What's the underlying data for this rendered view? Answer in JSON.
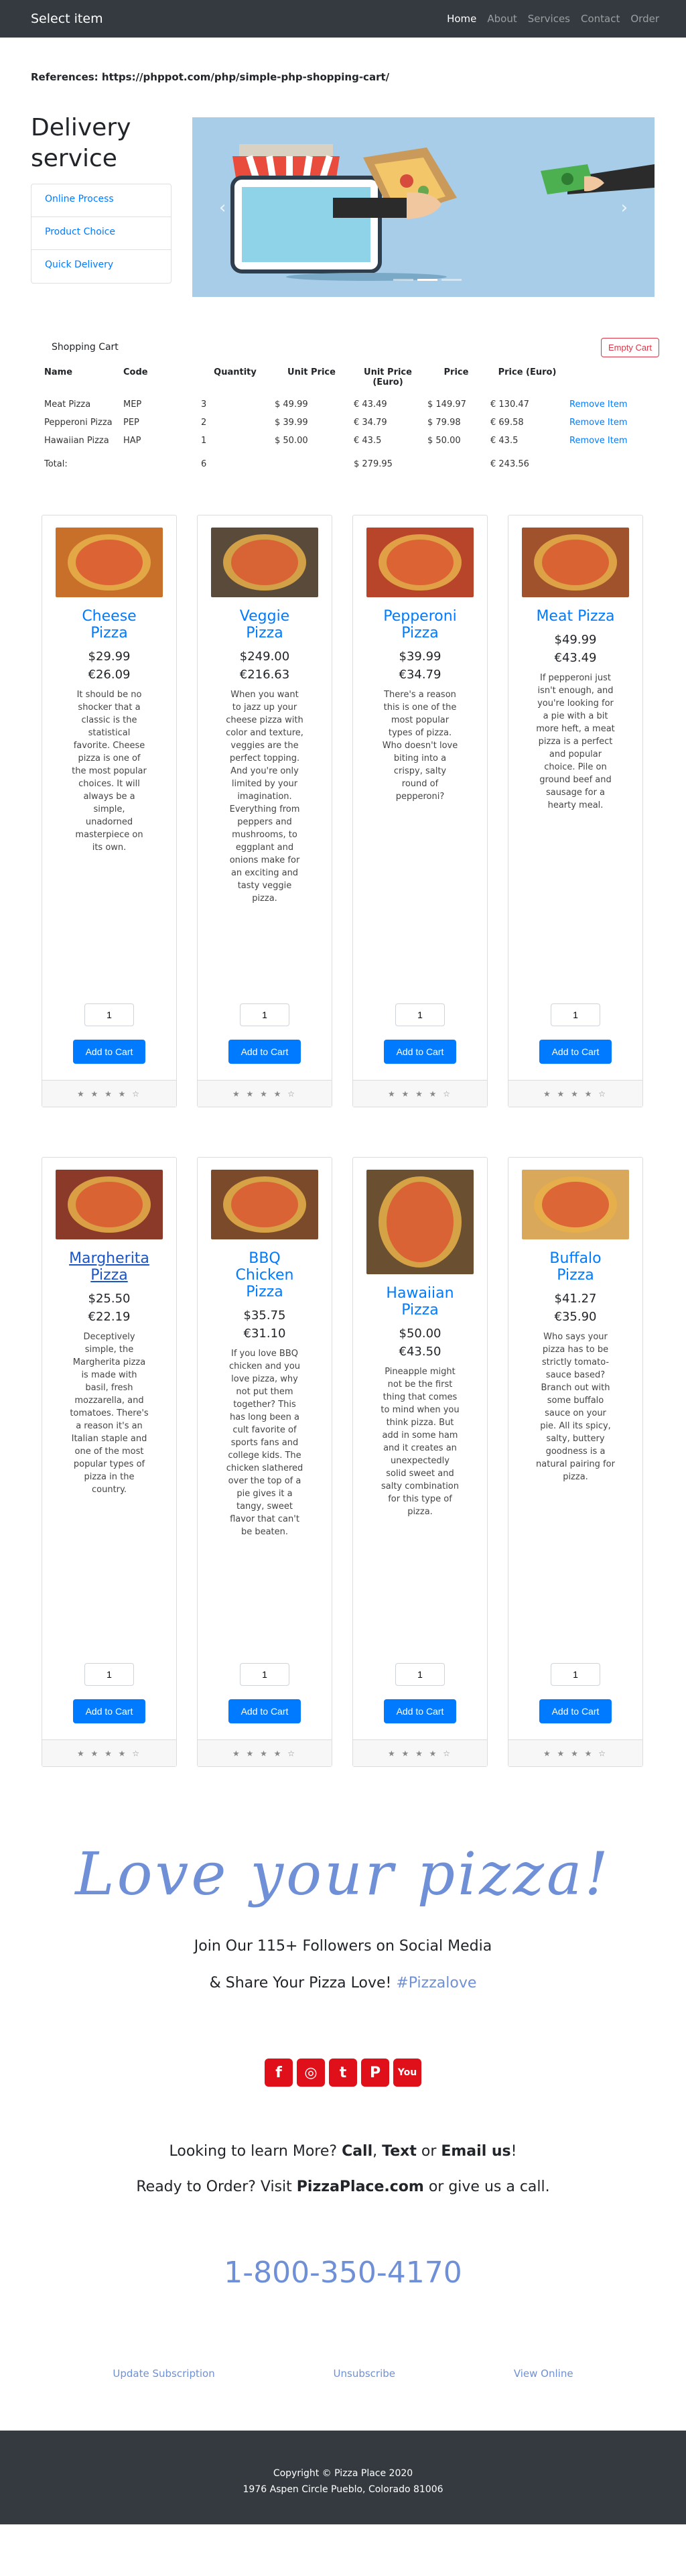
{
  "nav": {
    "brand": "Select item",
    "links": [
      "Home",
      "About",
      "Services",
      "Contact",
      "Order"
    ]
  },
  "references": "References: https://phppot.com/php/simple-php-shopping-cart/",
  "hero": {
    "title_line1": "Delivery",
    "title_line2": "service",
    "side_items": [
      "Online Process",
      "Product Choice",
      "Quick Delivery"
    ],
    "carousel": {
      "prev": "‹",
      "next": "›"
    }
  },
  "cart": {
    "title": "Shopping Cart",
    "empty_label": "Empty Cart",
    "columns": [
      "Name",
      "Code",
      "Quantity",
      "Unit Price",
      "Unit Price (Euro)",
      "Price",
      "Price (Euro)"
    ],
    "rows": [
      {
        "name": "Meat Pizza",
        "code": "MEP",
        "qty": "3",
        "unit": "$ 49.99",
        "unit_eur": "€ 43.49",
        "price": "$ 149.97",
        "price_eur": "€ 130.47",
        "remove": "Remove Item"
      },
      {
        "name": "Pepperoni Pizza",
        "code": "PEP",
        "qty": "2",
        "unit": "$ 39.99",
        "unit_eur": "€ 34.79",
        "price": "$ 79.98",
        "price_eur": "€ 69.58",
        "remove": "Remove Item"
      },
      {
        "name": "Hawaiian Pizza",
        "code": "HAP",
        "qty": "1",
        "unit": "$ 50.00",
        "unit_eur": "€ 43.5",
        "price": "$ 50.00",
        "price_eur": "€ 43.5",
        "remove": "Remove Item"
      }
    ],
    "total_label": "Total:",
    "total_qty": "6",
    "total_usd": "$ 279.95",
    "total_eur": "€ 243.56"
  },
  "products": [
    {
      "name": "Cheese Pizza",
      "price": "$29.99",
      "price_eur": "€26.09",
      "desc": "It should be no shocker that a classic is the statistical favorite. Cheese pizza is one of the most popular choices. It will always be a simple, unadorned masterpiece on its own.",
      "qty": "1",
      "btn": "Add to Cart",
      "stars": "★ ★ ★ ★ ☆",
      "color": "#c8702a"
    },
    {
      "name": "Veggie Pizza",
      "price": "$249.00",
      "price_eur": "€216.63",
      "desc": "When you want to jazz up your cheese pizza with color and texture, veggies are the perfect topping. And you're only limited by your imagination. Everything from peppers and mushrooms, to eggplant and onions make for an exciting and tasty veggie pizza.",
      "qty": "1",
      "btn": "Add to Cart",
      "stars": "★ ★ ★ ★ ☆",
      "color": "#5a4a3a"
    },
    {
      "name": "Pepperoni Pizza",
      "price": "$39.99",
      "price_eur": "€34.79",
      "desc": "There's a reason this is one of the most popular types of pizza. Who doesn't love biting into a crispy, salty round of pepperoni?",
      "qty": "1",
      "btn": "Add to Cart",
      "stars": "★ ★ ★ ★ ☆",
      "color": "#b8442a"
    },
    {
      "name": "Meat Pizza",
      "price": "$49.99",
      "price_eur": "€43.49",
      "desc": "If pepperoni just isn't enough, and you're looking for a pie with a bit more heft, a meat pizza is a perfect and popular choice. Pile on ground beef and sausage for a hearty meal.",
      "qty": "1",
      "btn": "Add to Cart",
      "stars": "★ ★ ★ ★ ☆",
      "color": "#a0522d"
    },
    {
      "name": "Margherita Pizza",
      "price": "$25.50",
      "price_eur": "€22.19",
      "desc": "Deceptively simple, the Margherita pizza is made with basil, fresh mozzarella, and tomatoes. There's a reason it's an Italian staple and one of the most popular types of pizza in the country.",
      "qty": "1",
      "btn": "Add to Cart",
      "stars": "★ ★ ★ ★ ☆",
      "color": "#8b3a2a"
    },
    {
      "name": "BBQ Chicken Pizza",
      "price": "$35.75",
      "price_eur": "€31.10",
      "desc": "If you love BBQ chicken and you love pizza, why not put them together? This has long been a cult favorite of sports fans and college kids. The chicken slathered over the top of a pie gives it a tangy, sweet flavor that can't be beaten.",
      "qty": "1",
      "btn": "Add to Cart",
      "stars": "★ ★ ★ ★ ☆",
      "color": "#7a4a2a"
    },
    {
      "name": "Hawaiian Pizza",
      "price": "$50.00",
      "price_eur": "€43.50",
      "desc": "Pineapple might not be the first thing that comes to mind when you think pizza. But add in some ham and it creates an unexpectedly solid sweet and salty combination for this type of pizza.",
      "qty": "1",
      "btn": "Add to Cart",
      "stars": "★ ★ ★ ★ ☆",
      "color": "#6a5030"
    },
    {
      "name": "Buffalo Pizza",
      "price": "$41.27",
      "price_eur": "€35.90",
      "desc": "Who says your pizza has to be strictly tomato-sauce based? Branch out with some buffalo sauce on your pie. All its spicy, salty, buttery goodness is a natural pairing for pizza.",
      "qty": "1",
      "btn": "Add to Cart",
      "stars": "★ ★ ★ ★ ☆",
      "color": "#d9a85a"
    }
  ],
  "promo": {
    "love": "Love your pizza!",
    "followers": "Join Our 115+ Followers on Social Media",
    "share_prefix": "& Share Your Pizza Love! ",
    "share_tag": "#Pizzalove",
    "social": [
      "facebook-icon",
      "instagram-icon",
      "twitter-icon",
      "pinterest-icon",
      "youtube-icon"
    ],
    "learn_prefix": "Looking to learn More? ",
    "learn_call": "Call",
    "learn_sep1": ", ",
    "learn_text": "Text",
    "learn_sep2": " or ",
    "learn_email": "Email us",
    "learn_end": "!",
    "ready_prefix": "Ready to Order? Visit ",
    "ready_site": "PizzaPlace.com",
    "ready_suffix": " or give us a call.",
    "phone": "1-800-350-4170",
    "links": [
      "Update Subscription",
      "Unsubscribe",
      "View Online"
    ]
  },
  "footer": {
    "copyright": "Copyright © Pizza Place 2020",
    "address": "1976 Aspen Circle Pueblo, Colorado 81006"
  }
}
